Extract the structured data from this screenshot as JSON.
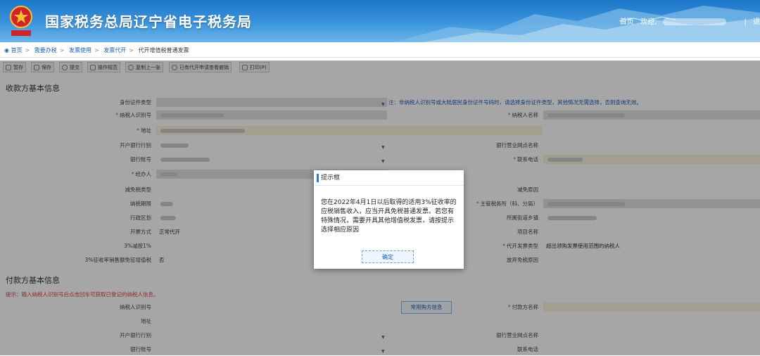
{
  "header": {
    "site_title": "国家税务总局辽宁省电子税务局",
    "home_link": "首页",
    "welcome_text": "欢迎,",
    "divider": "|",
    "more_link": "退"
  },
  "breadcrumb": [
    {
      "label": "首页",
      "link": true
    },
    {
      "label": "我要办税",
      "link": true
    },
    {
      "label": "发票使用",
      "link": true
    },
    {
      "label": "发票代开",
      "link": true
    },
    {
      "label": "代开增值税普通发票",
      "link": false
    }
  ],
  "toolbar": {
    "buttons": [
      "暂存",
      "保存",
      "提交",
      "操作规范",
      "复制上一张",
      "已有代开申请查看撤销",
      "打印(P)"
    ]
  },
  "payee_section": {
    "title": "收款方基本信息",
    "id_type_label": "身份证件类型",
    "id_note": "注：非纳税人识别号或大陆居民身份证件号码时，请选择身份证件类型，其他情况无需选择，否则查询无效。",
    "taxpayer_id_label": "纳税人识别号",
    "taxpayer_name_label": "纳税人名称",
    "address_label": "地址",
    "bank_label": "开户银行行别",
    "bank_branch_label": "银行营业网点名称",
    "account_label": "银行账号",
    "phone_label": "联系电话",
    "handler_label": "经办人",
    "reduction_type_label": "减免税类型",
    "reduction_reason_label": "减免原因",
    "tax_period_label": "纳税期限",
    "tax_authority_label": "主管税务所（科、分局）",
    "admin_region_label": "行政区划",
    "street_label": "所属街道乡镇",
    "issue_method_label": "开票方式",
    "issue_method_value": "正常代开",
    "project_name_label": "项目名称",
    "reduce_1pct_label": "3%减按1%",
    "invoice_type_label": "代开发票类型",
    "invoice_type_value": "超出领购发票使用范围的纳税人",
    "waiver_label": "3%征收率销售额免征增值税",
    "waiver_value": "否",
    "abandon_label": "放弃免税原因"
  },
  "payer_section": {
    "title": "付款方基本信息",
    "hint": "提示：输入纳税人识别号后点击回车可获取已登记的纳税人信息。",
    "taxpayer_id_label": "纳税人识别号",
    "common_payer_button": "常用购方信息",
    "payer_name_label": "付款方名称",
    "address_label": "地址",
    "bank_label": "开户银行行别",
    "bank_branch_label": "银行营业网点名称",
    "account_label": "银行账号",
    "phone_label": "联系电话"
  },
  "dialog": {
    "title": "提示框",
    "message": "您在2022年4月1日以后取得的适用3%征收率的应税销售收入，应当开具免税普通发票。若您有特殊情况，需要开具其他增值税发票，请按提示选择相应原因",
    "ok_label": "确定"
  },
  "colors": {
    "header_blue": "#1c76c8",
    "link_blue": "#1a5fb4",
    "required_red": "#e04040",
    "field_cream": "#fbf5de"
  }
}
